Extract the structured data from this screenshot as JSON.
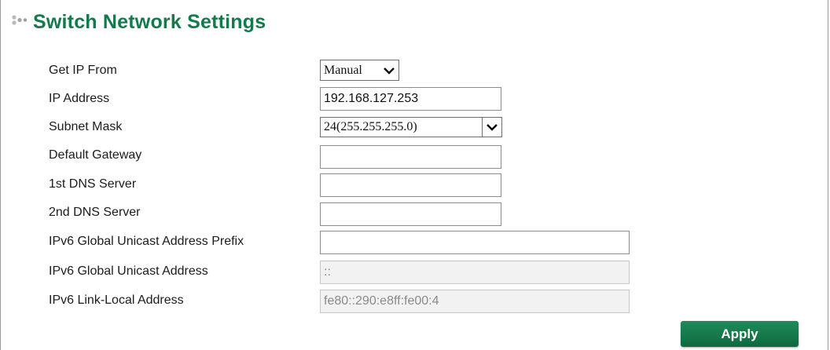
{
  "page": {
    "title": "Switch Network Settings",
    "accent_color": "#137a4c"
  },
  "form": {
    "get_ip_from": {
      "label": "Get IP From",
      "selected": "Manual",
      "icon": "chevron-down-icon"
    },
    "ip_address": {
      "label": "IP Address",
      "value": "192.168.127.253"
    },
    "subnet_mask": {
      "label": "Subnet Mask",
      "selected": "24(255.255.255.0)",
      "icon": "chevron-down-icon"
    },
    "default_gateway": {
      "label": "Default Gateway",
      "value": ""
    },
    "dns1": {
      "label": "1st DNS Server",
      "value": ""
    },
    "dns2": {
      "label": "2nd DNS Server",
      "value": ""
    },
    "ipv6_prefix": {
      "label": "IPv6 Global Unicast Address Prefix",
      "value": ""
    },
    "ipv6_global": {
      "label": "IPv6 Global Unicast Address",
      "value": "::"
    },
    "ipv6_link_local": {
      "label": "IPv6 Link-Local Address",
      "value": "fe80::290:e8ff:fe00:4"
    }
  },
  "actions": {
    "apply_label": "Apply",
    "apply_color": "#137a4c"
  }
}
